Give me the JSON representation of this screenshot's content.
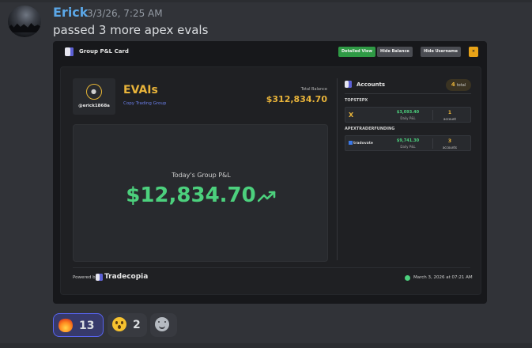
{
  "message": {
    "author": "Erick",
    "timestamp": "3/3/26, 7:25 AM",
    "text": "passed 3 more apex evals"
  },
  "embed": {
    "header_title": "Group P&L Card",
    "buttons": {
      "detailed_view": "Detailed View",
      "hide_balance": "Hide Balance",
      "hide_username": "Hide Username",
      "close": "×"
    },
    "user": {
      "handle": "@erick1868a"
    },
    "group": {
      "name": "EVAIs",
      "link": "Copy Trading Group",
      "total_balance_label": "Total Balance",
      "total_balance": "$312,834.70"
    },
    "pnl": {
      "label": "Today's Group P&L",
      "value": "$12,834.70"
    },
    "accounts": {
      "title": "Accounts",
      "total_count": "4",
      "total_label": "total",
      "groups": [
        {
          "name": "TOPSTEPX",
          "logo_text": "X",
          "amount": "$3,093.40",
          "amount_label": "Daily P&L",
          "count": "1",
          "count_label": "account"
        },
        {
          "name": "APEXTRADERFUNDING",
          "logo_text": "tradovate",
          "amount": "$9,741.30",
          "amount_label": "Daily P&L",
          "count": "3",
          "count_label": "accounts"
        }
      ]
    },
    "footer": {
      "powered_by": "Powered by",
      "brand": "Tradecopia",
      "date": "March 3, 2026 at 07:21 AM"
    }
  },
  "reactions": [
    {
      "emoji": "fire-emoji",
      "count": "13",
      "active": true
    },
    {
      "emoji": "astonished-emoji",
      "count": "2",
      "active": false
    },
    {
      "emoji": "add-reaction-icon",
      "count": "",
      "active": false
    }
  ],
  "colors": {
    "accent_gold": "#e9b43a",
    "profit_green": "#4cd07d",
    "username_blue": "#5ba7e7",
    "reaction_active": "#5865f2"
  }
}
